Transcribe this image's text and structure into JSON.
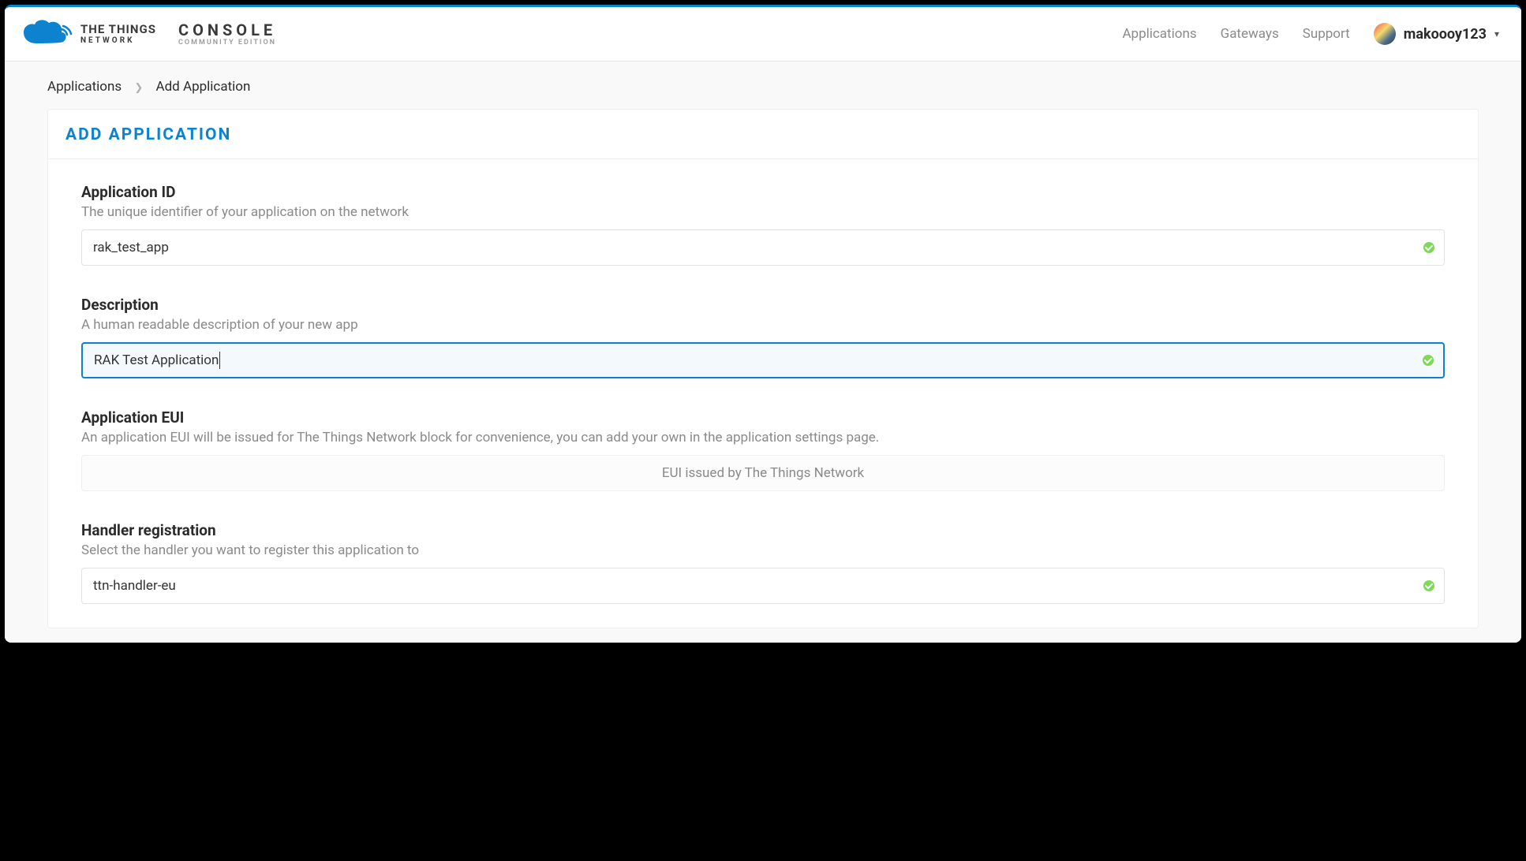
{
  "brand": {
    "line1": "THE THINGS",
    "line2": "NETWORK",
    "console": "CONSOLE",
    "edition": "COMMUNITY EDITION"
  },
  "nav": {
    "applications": "Applications",
    "gateways": "Gateways",
    "support": "Support"
  },
  "user": {
    "name": "makoooy123"
  },
  "breadcrumb": {
    "root": "Applications",
    "current": "Add Application"
  },
  "page": {
    "title": "ADD APPLICATION"
  },
  "fields": {
    "app_id": {
      "label": "Application ID",
      "help": "The unique identifier of your application on the network",
      "value": "rak_test_app"
    },
    "description": {
      "label": "Description",
      "help": "A human readable description of your new app",
      "value": "RAK Test Application"
    },
    "app_eui": {
      "label": "Application EUI",
      "help": "An application EUI will be issued for The Things Network block for convenience, you can add your own in the application settings page.",
      "placeholder": "EUI issued by The Things Network"
    },
    "handler": {
      "label": "Handler registration",
      "help": "Select the handler you want to register this application to",
      "value": "ttn-handler-eu"
    }
  }
}
